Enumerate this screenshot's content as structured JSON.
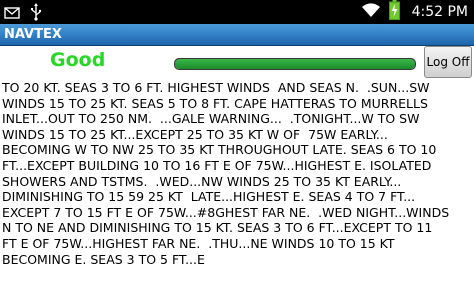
{
  "status_bar": {
    "time": "4:52 PM",
    "icons": [
      "message-icon",
      "usb-icon",
      "wifi-icon",
      "battery-charging-icon"
    ]
  },
  "app": {
    "title": "NAVTEX"
  },
  "controls": {
    "status_text": "Good",
    "status_color": "#27d827",
    "signal_level_percent": 100,
    "logoff_label": "Log Off"
  },
  "message_lines": [
    "TO 20 KT. SEAS 3 TO 6 FT. HIGHEST WINDS  AND SEAS N.  .SUN...SW",
    "WINDS 15 TO 25 KT. SEAS 5 TO 8 FT. CAPE HATTERAS TO MURRELLS",
    "INLET...OUT TO 250 NM.  ...GALE WARNING...  .TONIGHT...W TO SW",
    "WINDS 15 TO 25 KT...EXCEPT 25 TO 35 KT W OF  75W EARLY...",
    "BECOMING W TO NW 25 TO 35 KT THROUGHOUT LATE. SEAS 6 TO 10",
    "FT...EXCEPT BUILDING 10 TO 16 FT E OF 75W...HIGHEST E. ISOLATED",
    "SHOWERS AND TSTMS.  .WED...NW WINDS 25 TO 35 KT EARLY...",
    "DIMINISHING TO 15 59 25 KT  LATE...HIGHEST E. SEAS 4 TO 7 FT...",
    "EXCEPT 7 TO 15 FT E OF 75W...#8GHEST FAR NE.  .WED NIGHT...WINDS",
    "N TO NE AND DIMINISHING TO 15 KT. SEAS 3 TO 6 FT...EXCEPT TO 11",
    "FT E OF 75W...HIGHEST FAR NE.  .THU...NE WINDS 10 TO 15 KT",
    "BECOMING E. SEAS 3 TO 5 FT...E",
    ""
  ]
}
